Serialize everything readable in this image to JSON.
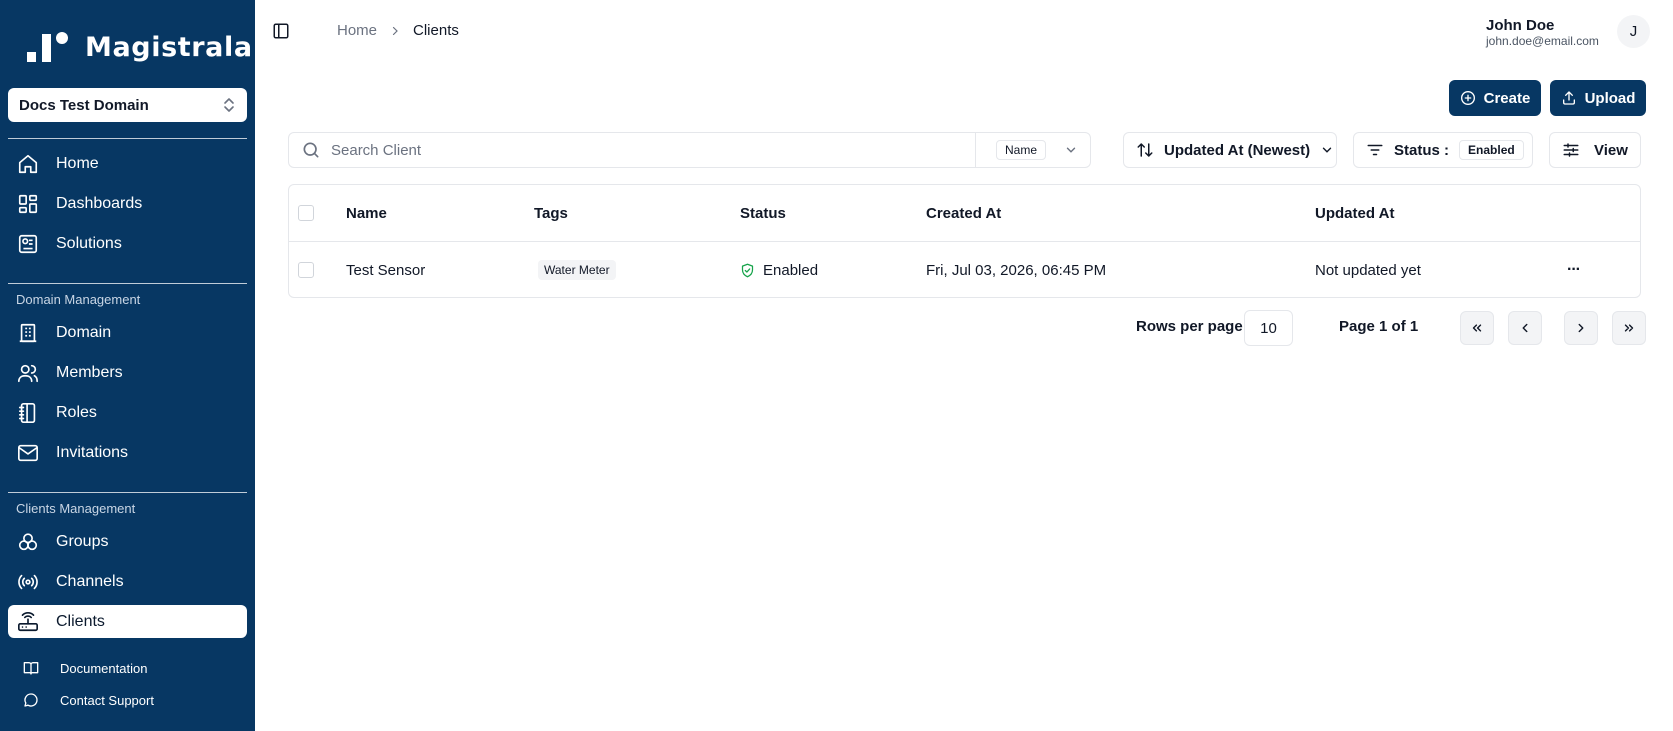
{
  "brand": {
    "name": "Magistrala"
  },
  "sidebar": {
    "domain_selector": "Docs Test Domain",
    "main_items": [
      {
        "label": "Home",
        "icon": "home-icon"
      },
      {
        "label": "Dashboards",
        "icon": "dashboard-icon"
      },
      {
        "label": "Solutions",
        "icon": "solutions-icon"
      }
    ],
    "domain_management": {
      "label": "Domain Management",
      "items": [
        {
          "label": "Domain",
          "icon": "building-icon"
        },
        {
          "label": "Members",
          "icon": "users-icon"
        },
        {
          "label": "Roles",
          "icon": "notebook-icon"
        },
        {
          "label": "Invitations",
          "icon": "mail-icon"
        }
      ]
    },
    "clients_management": {
      "label": "Clients Management",
      "items": [
        {
          "label": "Groups",
          "icon": "groups-icon"
        },
        {
          "label": "Channels",
          "icon": "radio-icon"
        },
        {
          "label": "Clients",
          "icon": "router-icon",
          "active": true
        }
      ]
    },
    "footer": [
      {
        "label": "Documentation",
        "icon": "book-icon"
      },
      {
        "label": "Contact Support",
        "icon": "chat-icon"
      }
    ]
  },
  "header": {
    "breadcrumb": {
      "home": "Home",
      "current": "Clients"
    },
    "user": {
      "name": "John Doe",
      "email": "john.doe@email.com",
      "initial": "J"
    }
  },
  "actions": {
    "create": "Create",
    "upload": "Upload"
  },
  "toolbar": {
    "search_placeholder": "Search Client",
    "search_value": "",
    "search_field": "Name",
    "sort": "Updated At (Newest)",
    "status_label": "Status :",
    "status_value": "Enabled",
    "view": "View"
  },
  "table": {
    "columns": [
      "Name",
      "Tags",
      "Status",
      "Created At",
      "Updated At"
    ],
    "rows": [
      {
        "name": "Test Sensor",
        "tag": "Water Meter",
        "status": "Enabled",
        "created_at": "Fri, Jul 03, 2026, 06:45 PM",
        "updated_at": "Not updated yet",
        "more": "···"
      }
    ]
  },
  "pagination": {
    "rows_per_page_label": "Rows per page",
    "rows_per_page": "10",
    "page_label": "Page 1 of 1"
  },
  "colors": {
    "sidebar_bg": "#073763",
    "primary": "#073763",
    "status_ok": "#16a34a"
  }
}
